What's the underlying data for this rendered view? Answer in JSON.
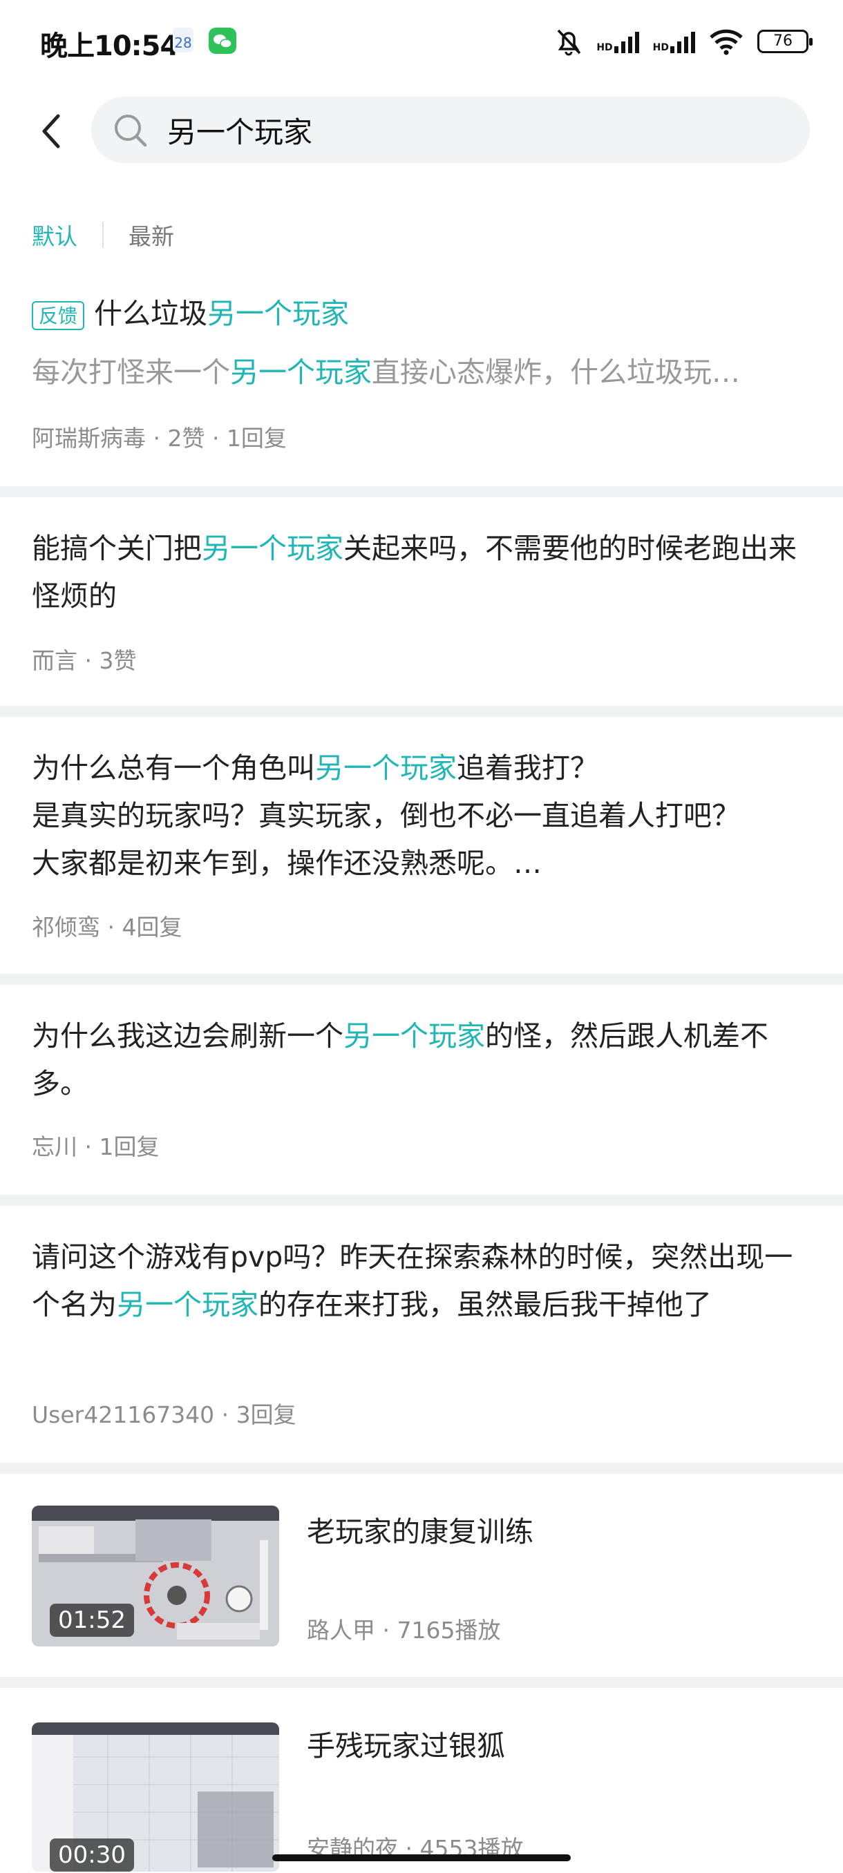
{
  "status_bar": {
    "time": "晚上10:54",
    "calendar_day": "28",
    "battery": "76",
    "hd_label": "HD"
  },
  "search": {
    "query": "另一个玩家"
  },
  "sort_tabs": {
    "default_label": "默认",
    "latest_label": "最新"
  },
  "accent_color": "#20b6b6",
  "posts": [
    {
      "tag": "反馈",
      "title_pre": "什么垃圾",
      "title_hl": "另一个玩家",
      "excerpt_pre": "每次打怪来一个",
      "excerpt_hl": "另一个玩家",
      "excerpt_post": "直接心态爆炸，什么垃圾玩…",
      "meta": "阿瑞斯病毒 · 2赞 · 1回复"
    },
    {
      "title_pre": "能搞个关门把",
      "title_hl": "另一个玩家",
      "title_post": "关起来吗，不需要他的时候老跑出来怪烦的",
      "meta": "而言 · 3赞"
    },
    {
      "title_pre": "为什么总有一个角色叫",
      "title_hl": "另一个玩家",
      "title_post": "追着我打？",
      "line2": "是真实的玩家吗？真实玩家，倒也不必一直追着人打吧？",
      "line3": "大家都是初来乍到，操作还没熟悉呢。…",
      "meta": "祁倾鸾 · 4回复"
    },
    {
      "title_pre": "为什么我这边会刷新一个",
      "title_hl": "另一个玩家",
      "title_post": "的怪，然后跟人机差不多。",
      "meta": "忘川 · 1回复"
    },
    {
      "title_pre": "请问这个游戏有pvp吗？昨天在探索森林的时候，突然出现一个名为",
      "title_hl": "另一个玩家",
      "title_post": "的存在来打我，虽然最后我干掉他了",
      "meta": "User421167340 · 3回复"
    }
  ],
  "videos": [
    {
      "title": "老玩家的康复训练",
      "duration": "01:52",
      "meta": "路人甲 · 7165播放"
    },
    {
      "title": "手残玩家过银狐",
      "duration": "00:30",
      "meta": "安静的夜 · 4553播放"
    }
  ]
}
